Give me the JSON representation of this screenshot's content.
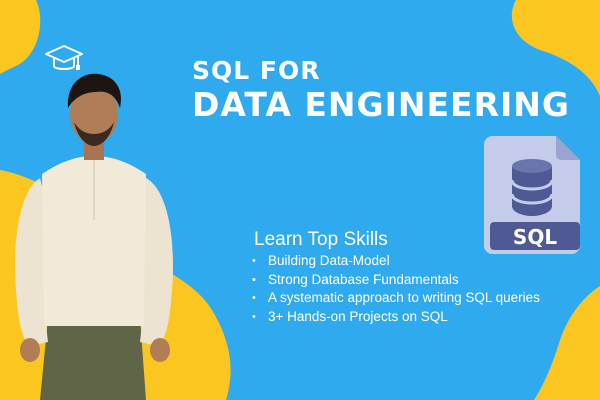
{
  "colors": {
    "background": "#2faaef",
    "accent_yellow": "#fcc621",
    "text": "#ffffff",
    "shirt": "#f1ead8",
    "pants": "#606548",
    "icon_file": "#c5cce9",
    "icon_file_fold": "#9aa3d3",
    "icon_dark": "#4f5a94",
    "icon_label_bar": "#4f5a94"
  },
  "graduation_cap": {
    "icon": "graduation-cap-icon"
  },
  "title": {
    "line1": "SQL FOR",
    "line2": "DATA ENGINEERING"
  },
  "sql_icon": {
    "icon": "database-file-icon",
    "label": "SQL"
  },
  "skills": {
    "heading": "Learn Top Skills",
    "bullet": "•",
    "items": [
      "Building Data-Model",
      "Strong Database Fundamentals",
      "A systematic approach to writing SQL queries",
      "3+ Hands-on Projects on SQL"
    ]
  }
}
